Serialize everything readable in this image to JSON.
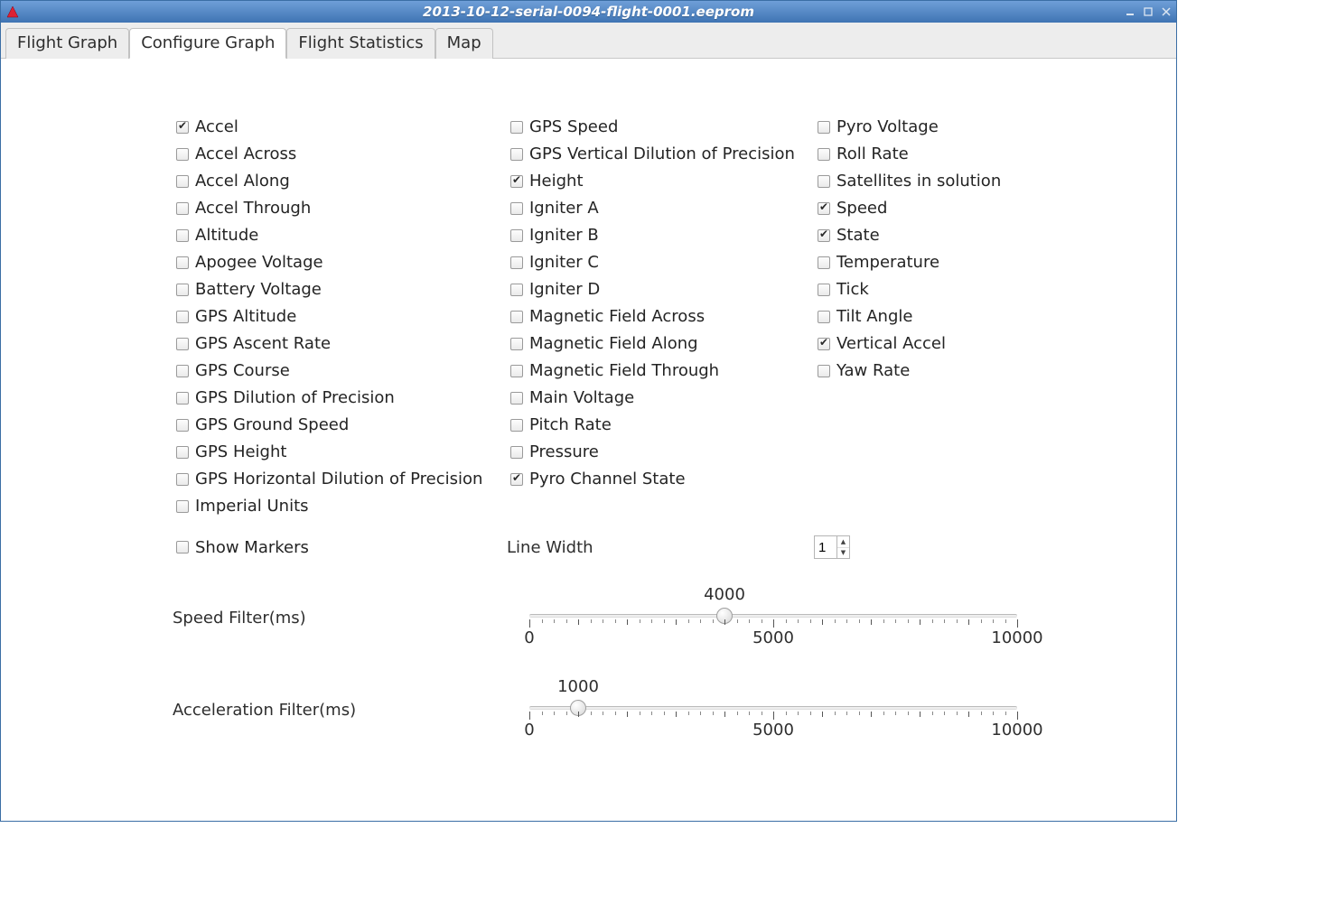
{
  "window": {
    "title": "2013-10-12-serial-0094-flight-0001.eeprom"
  },
  "tabs": [
    {
      "label": "Flight Graph",
      "active": false
    },
    {
      "label": "Configure Graph",
      "active": true
    },
    {
      "label": "Flight Statistics",
      "active": false
    },
    {
      "label": "Map",
      "active": false
    }
  ],
  "checkboxes": {
    "col1": [
      {
        "label": "Accel",
        "checked": true
      },
      {
        "label": "Accel Across",
        "checked": false
      },
      {
        "label": "Accel Along",
        "checked": false
      },
      {
        "label": "Accel Through",
        "checked": false
      },
      {
        "label": "Altitude",
        "checked": false
      },
      {
        "label": "Apogee Voltage",
        "checked": false
      },
      {
        "label": "Battery Voltage",
        "checked": false
      },
      {
        "label": "GPS Altitude",
        "checked": false
      },
      {
        "label": "GPS Ascent Rate",
        "checked": false
      },
      {
        "label": "GPS Course",
        "checked": false
      },
      {
        "label": "GPS Dilution of Precision",
        "checked": false
      },
      {
        "label": "GPS Ground Speed",
        "checked": false
      },
      {
        "label": "GPS Height",
        "checked": false
      },
      {
        "label": "GPS Horizontal Dilution of Precision",
        "checked": false
      },
      {
        "label": "Imperial Units",
        "checked": false
      }
    ],
    "col2": [
      {
        "label": "GPS Speed",
        "checked": false
      },
      {
        "label": "GPS Vertical Dilution of Precision",
        "checked": false
      },
      {
        "label": "Height",
        "checked": true
      },
      {
        "label": "Igniter A",
        "checked": false
      },
      {
        "label": "Igniter B",
        "checked": false
      },
      {
        "label": "Igniter C",
        "checked": false
      },
      {
        "label": "Igniter D",
        "checked": false
      },
      {
        "label": "Magnetic Field Across",
        "checked": false
      },
      {
        "label": "Magnetic Field Along",
        "checked": false
      },
      {
        "label": "Magnetic Field Through",
        "checked": false
      },
      {
        "label": "Main Voltage",
        "checked": false
      },
      {
        "label": "Pitch Rate",
        "checked": false
      },
      {
        "label": "Pressure",
        "checked": false
      },
      {
        "label": "Pyro Channel State",
        "checked": true
      }
    ],
    "col3": [
      {
        "label": "Pyro Voltage",
        "checked": false
      },
      {
        "label": "Roll Rate",
        "checked": false
      },
      {
        "label": "Satellites in solution",
        "checked": false
      },
      {
        "label": "Speed",
        "checked": true
      },
      {
        "label": "State",
        "checked": true
      },
      {
        "label": "Temperature",
        "checked": false
      },
      {
        "label": "Tick",
        "checked": false
      },
      {
        "label": "Tilt Angle",
        "checked": false
      },
      {
        "label": "Vertical Accel",
        "checked": true
      },
      {
        "label": "Yaw Rate",
        "checked": false
      }
    ]
  },
  "show_markers": {
    "label": "Show Markers",
    "checked": false
  },
  "line_width": {
    "label": "Line Width",
    "value": "1"
  },
  "speed_filter": {
    "label": "Speed Filter(ms)",
    "value": 4000,
    "min": 0,
    "mid": 5000,
    "max": 10000
  },
  "accel_filter": {
    "label": "Acceleration Filter(ms)",
    "value": 1000,
    "min": 0,
    "mid": 5000,
    "max": 10000
  }
}
